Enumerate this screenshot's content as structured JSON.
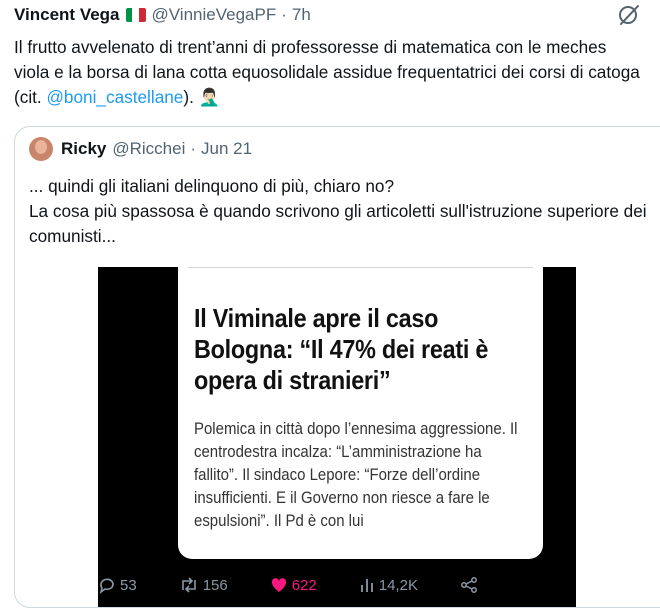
{
  "tweet": {
    "author_name": "Vincent Vega",
    "author_flag": "italy-flag-emoji",
    "author_handle": "@VinnieVegaPF",
    "separator": "·",
    "time": "7h",
    "text_before": "Il frutto avvelenato di trent’anni di professoresse di matematica con le meches viola e la borsa di lana cotta equosolidale assidue frequentatrici dei corsi di catoga (cit. ",
    "mention": "@boni_castellane",
    "text_after": "). ",
    "emoji": "🤦🏻‍♂️"
  },
  "quote": {
    "author_name": "Ricky",
    "author_handle": "@Ricchei",
    "separator": "·",
    "date": "Jun 21",
    "line1": "... quindi gli italiani delinquono di più, chiaro no?",
    "line2": "La cosa più spassosa è quando scrivono gli articoletti sull'istruzione superiore dei comunisti...",
    "media": {
      "headline": "Il Viminale apre il caso Bologna: “Il 47% dei reati è opera di stranieri”",
      "summary": "Polemica in città dopo l’ennesima aggressione. Il centrodestra incalza: “L’amministrazione ha fallito”. Il sindaco Lepore: “Forze dell’ordine insufficienti. E il Governo non riesce a fare le espulsioni”. Il Pd è con lui",
      "actions": {
        "replies": "53",
        "retweets": "156",
        "likes": "622",
        "views": "14,2K"
      }
    }
  },
  "colors": {
    "accent": "#1d9bf0",
    "like": "#f91880",
    "muted": "#536471",
    "border": "#cfd9de"
  }
}
